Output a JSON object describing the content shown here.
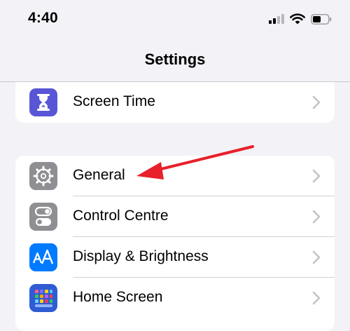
{
  "status_bar": {
    "time": "4:40",
    "icons": [
      "cellular-signal-icon",
      "wifi-icon",
      "battery-icon"
    ]
  },
  "header": {
    "title": "Settings"
  },
  "groups": [
    {
      "items": [
        {
          "label": "Screen Time",
          "icon": "hourglass-icon",
          "icon_color": "#5856d6"
        }
      ]
    },
    {
      "items": [
        {
          "label": "General",
          "icon": "gear-icon",
          "icon_color": "#8e8e93"
        },
        {
          "label": "Control Centre",
          "icon": "toggle-switches-icon",
          "icon_color": "#8e8e93"
        },
        {
          "label": "Display & Brightness",
          "icon": "text-size-icon",
          "icon_color": "#007aff"
        },
        {
          "label": "Home Screen",
          "icon": "app-grid-icon",
          "icon_color": "#2f5bd3"
        }
      ]
    }
  ],
  "annotation": {
    "type": "red-arrow",
    "target": "General",
    "color": "#e8202a"
  },
  "colors": {
    "background": "#f2f2f7",
    "cell": "#ffffff",
    "chevron": "#c4c4c7",
    "separator": "#d1d1d6"
  }
}
